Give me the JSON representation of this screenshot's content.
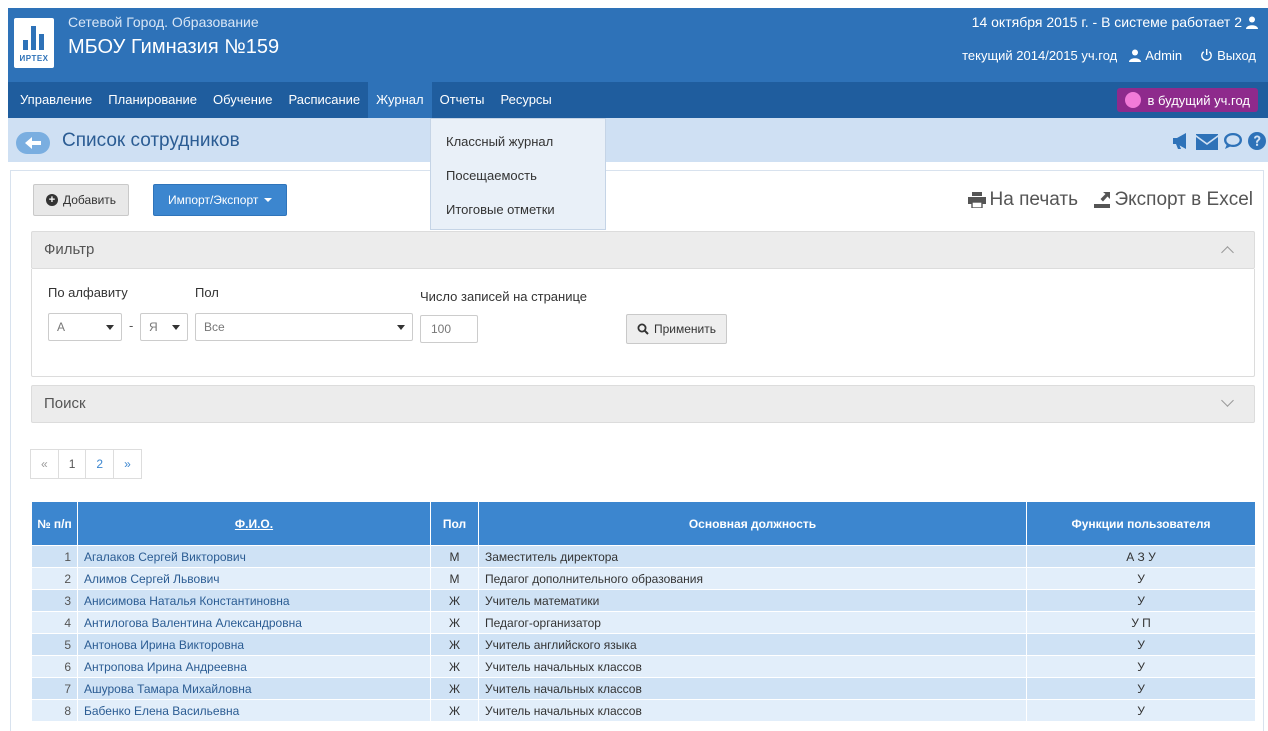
{
  "header": {
    "site_name": "Сетевой Город. Образование",
    "school_name": "МБОУ Гимназия №159",
    "logo_text": "ИРТЕХ",
    "date_line": "14 октября 2015 г. - В системе работает 2",
    "year_line": "текущий 2014/2015 уч.год",
    "user_label": "Admin",
    "logout_label": "Выход"
  },
  "menu": {
    "items": [
      "Управление",
      "Планирование",
      "Обучение",
      "Расписание",
      "Журнал",
      "Отчеты",
      "Ресурсы"
    ],
    "active": "Журнал",
    "future_year_label": "в будущий уч.год"
  },
  "journal_dropdown": [
    "Классный журнал",
    "Посещаемость",
    "Итоговые отметки"
  ],
  "page": {
    "title": "Список сотрудников"
  },
  "toolbar": {
    "add_label": "Добавить",
    "import_export_label": "Импорт/Экспорт",
    "print_label": "На печать",
    "excel_label": "Экспорт в Excel"
  },
  "filter": {
    "heading": "Фильтр",
    "alphabet_label": "По алфавиту",
    "alpha_from": "А",
    "alpha_to": "Я",
    "gender_label": "Пол",
    "gender_value": "Все",
    "records_label": "Число записей на странице",
    "records_value": "100",
    "apply_label": "Применить"
  },
  "search": {
    "heading": "Поиск"
  },
  "pagination": {
    "prev": "«",
    "pages": [
      "1",
      "2"
    ],
    "next": "»"
  },
  "table": {
    "columns": [
      "№ п/п",
      "Ф.И.О.",
      "Пол",
      "Основная должность",
      "Функции пользователя"
    ],
    "rows": [
      {
        "num": "1",
        "name": "Агалаков Сергей Викторович",
        "gender": "М",
        "position": "Заместитель директора",
        "roles": "А З У"
      },
      {
        "num": "2",
        "name": "Алимов Сергей Львович",
        "gender": "М",
        "position": "Педагог дополнительного образования",
        "roles": "У"
      },
      {
        "num": "3",
        "name": "Анисимова Наталья Константиновна",
        "gender": "Ж",
        "position": "Учитель математики",
        "roles": "У"
      },
      {
        "num": "4",
        "name": "Антилогова Валентина Александровна",
        "gender": "Ж",
        "position": "Педагог-организатор",
        "roles": "У П"
      },
      {
        "num": "5",
        "name": "Антонова Ирина Викторовна",
        "gender": "Ж",
        "position": "Учитель английского языка",
        "roles": "У"
      },
      {
        "num": "6",
        "name": "Антропова Ирина Андреевна",
        "gender": "Ж",
        "position": "Учитель начальных классов",
        "roles": "У"
      },
      {
        "num": "7",
        "name": "Ашурова Тамара Михайловна",
        "gender": "Ж",
        "position": "Учитель начальных классов",
        "roles": "У"
      },
      {
        "num": "8",
        "name": "Бабенко Елена Васильевна",
        "gender": "Ж",
        "position": "Учитель начальных классов",
        "roles": "У"
      }
    ]
  }
}
